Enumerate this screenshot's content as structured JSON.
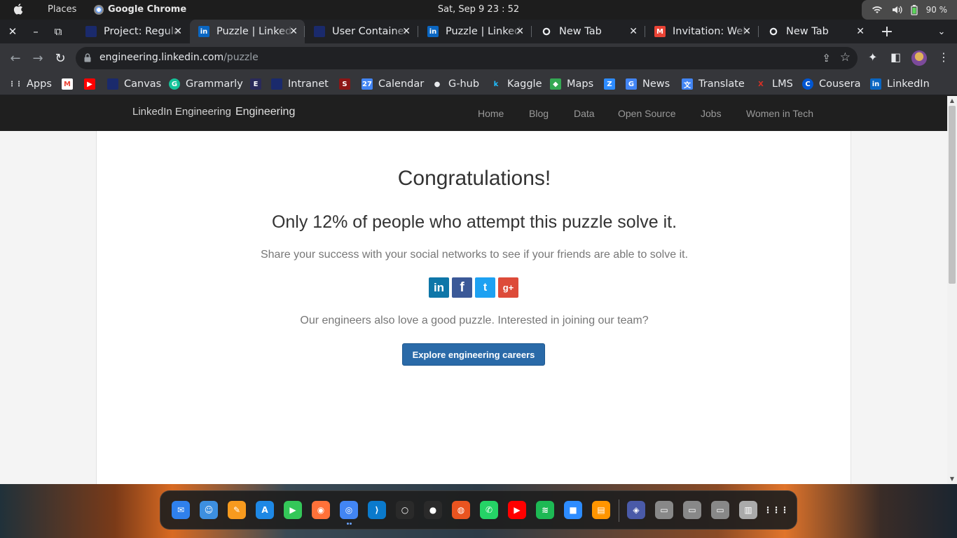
{
  "system": {
    "places": "Places",
    "app_name": "Google Chrome",
    "clock": "Sat, Sep 9  23 : 52",
    "battery": "90 %"
  },
  "tabs": [
    {
      "title": "Project: Regular Expression",
      "icon": "university-icon",
      "color": "#1a2a6c"
    },
    {
      "title": "Puzzle | LinkedIn",
      "icon": "linkedin-icon",
      "color": "#0a66c2",
      "active": true
    },
    {
      "title": "User Containers",
      "icon": "university-icon",
      "color": "#1a2a6c"
    },
    {
      "title": "Puzzle | LinkedIn",
      "icon": "linkedin-icon",
      "color": "#0a66c2"
    },
    {
      "title": "New Tab",
      "icon": "chrome-icon",
      "color": "#5f6368"
    },
    {
      "title": "Invitation: Welcome",
      "icon": "gmail-icon",
      "color": "#ea4335"
    },
    {
      "title": "New Tab",
      "icon": "chrome-icon",
      "color": "#5f6368"
    }
  ],
  "address": {
    "host": "engineering.linkedin.com",
    "path": "/puzzle"
  },
  "bookmarks": [
    {
      "label": "Apps",
      "icon": "apps-grid-icon"
    },
    {
      "label": "",
      "icon": "gmail-icon"
    },
    {
      "label": "",
      "icon": "youtube-icon"
    },
    {
      "label": "Canvas",
      "icon": "university-icon"
    },
    {
      "label": "Grammarly",
      "icon": "grammarly-icon"
    },
    {
      "label": "",
      "icon": "e-icon"
    },
    {
      "label": "Intranet",
      "icon": "university-icon"
    },
    {
      "label": "",
      "icon": "stanford-icon"
    },
    {
      "label": "Calendar",
      "icon": "calendar-icon"
    },
    {
      "label": "G-hub",
      "icon": "github-icon"
    },
    {
      "label": "Kaggle",
      "icon": "kaggle-icon"
    },
    {
      "label": "Maps",
      "icon": "maps-icon"
    },
    {
      "label": "",
      "icon": "zoom-icon"
    },
    {
      "label": "News",
      "icon": "news-icon"
    },
    {
      "label": "Translate",
      "icon": "translate-icon"
    },
    {
      "label": "LMS",
      "icon": "lms-icon"
    },
    {
      "label": "Cousera",
      "icon": "coursera-icon"
    },
    {
      "label": "LinkedIn",
      "icon": "linkedin-icon"
    }
  ],
  "site": {
    "brand_alt": "LinkedIn Engineering",
    "brand_text": "Engineering",
    "nav": [
      "Home",
      "Blog",
      "Data",
      "Open Source",
      "Jobs",
      "Women in Tech"
    ]
  },
  "main": {
    "title": "Congratulations!",
    "subtitle": "Only 12% of people who attempt this puzzle solve it.",
    "share_text": "Share your success with your social networks to see if your friends are able to solve it.",
    "share_buttons": [
      {
        "label": "in",
        "icon": "linkedin-share-icon",
        "color": "#0e76a8"
      },
      {
        "label": "f",
        "icon": "facebook-share-icon",
        "color": "#3b5998"
      },
      {
        "label": "t",
        "icon": "twitter-share-icon",
        "color": "#1da1f2"
      },
      {
        "label": "g+",
        "icon": "googleplus-share-icon",
        "color": "#dd4b39"
      }
    ],
    "join_text": "Our engineers also love a good puzzle. Interested in joining our team?",
    "cta_label": "Explore engineering careers"
  },
  "colors": {
    "cta": "#2a6aa8",
    "navbar": "#1f1f1f",
    "tab_bar": "#202124"
  }
}
